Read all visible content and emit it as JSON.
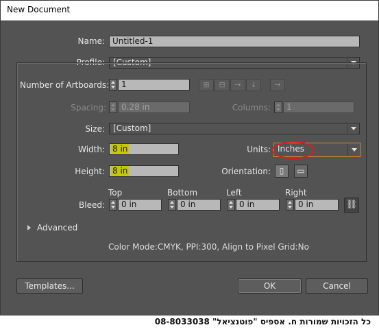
{
  "window": {
    "title": "New Document"
  },
  "name": {
    "label": "Name:",
    "value": "Untitled-1"
  },
  "profile": {
    "label": "Profile:",
    "value": "[Custom]"
  },
  "artboards": {
    "label": "Number of Artboards:",
    "value": "1",
    "layout_icons": [
      "grid-by-row-icon",
      "grid-by-column-icon",
      "arrange-by-row-icon",
      "arrange-by-column-icon",
      "right-to-left-icon"
    ]
  },
  "spacing": {
    "label": "Spacing:",
    "value": "0.28 in"
  },
  "columns": {
    "label": "Columns:",
    "value": "1"
  },
  "size": {
    "label": "Size:",
    "value": "[Custom]"
  },
  "width": {
    "label": "Width:",
    "value": "8 in"
  },
  "units": {
    "label": "Units:",
    "value": "Inches"
  },
  "height": {
    "label": "Height:",
    "value": "8 in"
  },
  "orientation": {
    "label": "Orientation:",
    "selected": "portrait"
  },
  "bleed": {
    "label": "Bleed:",
    "top": {
      "label": "Top",
      "value": "0 in"
    },
    "bottom": {
      "label": "Bottom",
      "value": "0 in"
    },
    "left": {
      "label": "Left",
      "value": "0 in"
    },
    "right": {
      "label": "Right",
      "value": "0 in"
    }
  },
  "advanced": {
    "label": "Advanced"
  },
  "summary": "Color Mode:CMYK, PPI:300, Align to Pixel Grid:No",
  "buttons": {
    "templates": "Templates...",
    "ok": "OK",
    "cancel": "Cancel"
  },
  "caption": "כל הזכויות שמורות ח. אספיס \"פוטנציאל\" 08-8033038",
  "colors": {
    "dialog_bg": "#535353",
    "field_bg": "#b8b8b8",
    "highlight": "#c8c800",
    "annotation": "#e01b1b"
  }
}
